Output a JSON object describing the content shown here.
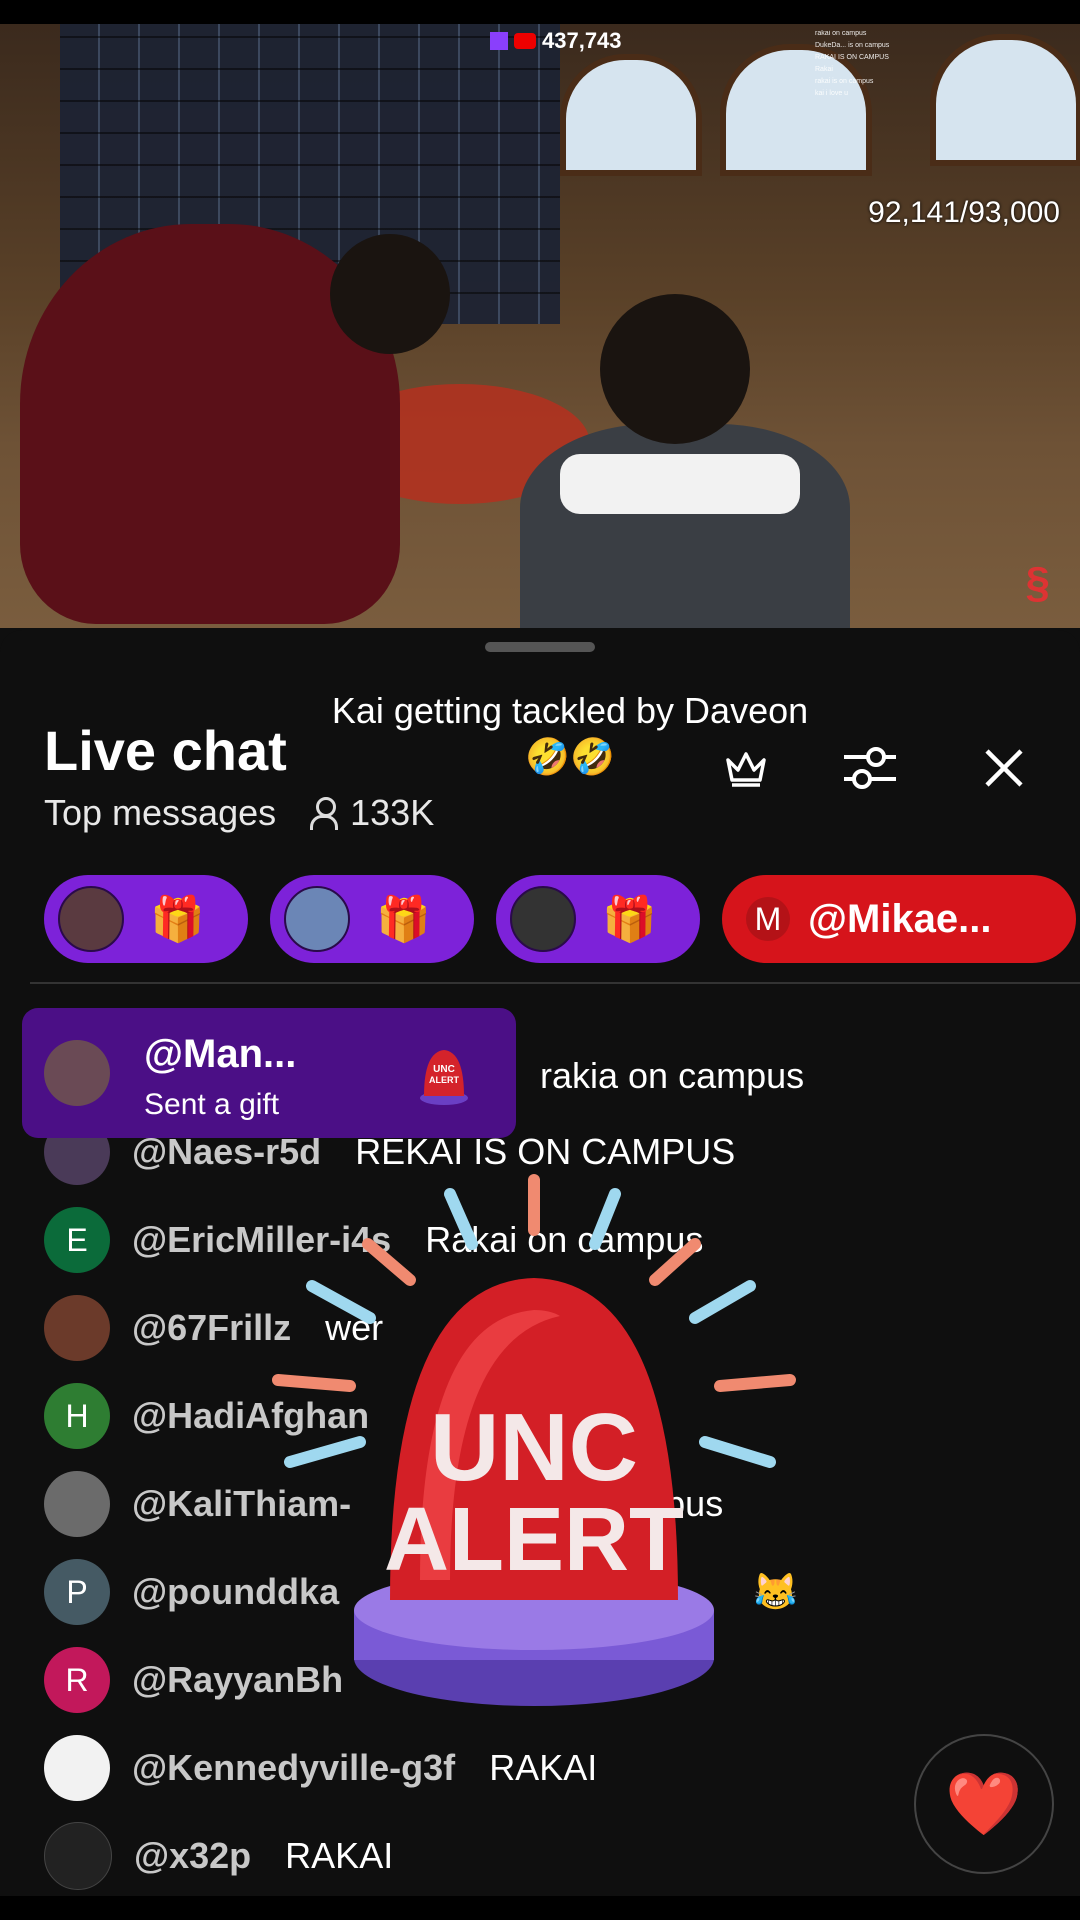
{
  "video": {
    "viewer_count": "437,743",
    "sub_counter": "92,141/93,000",
    "overlay_chat": [
      "rakai on campus",
      "DukeDa... is on campus",
      "RAKAI IS ON CAMPUS",
      "Rakai",
      "rakai is on campus",
      "kai i love u"
    ]
  },
  "chat": {
    "title": "Live chat",
    "mode": "Top messages",
    "viewers": "133K",
    "caption": "Kai getting tackled by Daveon🤣🤣",
    "icons": {
      "crown": "crown-icon",
      "filter": "sliders-icon",
      "close": "close-icon"
    }
  },
  "gifts": [
    {
      "icon": "gift-icon"
    },
    {
      "icon": "gift-icon"
    },
    {
      "icon": "gift-icon"
    }
  ],
  "mention": {
    "initial": "M",
    "handle": "@Mikae..."
  },
  "toast": {
    "name": "@Man...",
    "action": "Sent a gift",
    "badge": "UNC ALERT"
  },
  "messages": [
    {
      "initial": "",
      "user": "",
      "text": "rakia on campus",
      "avatar_color": "#3b2a3b"
    },
    {
      "initial": "",
      "user": "@Naes-r5d",
      "text": "REKAI IS ON CAMPUS",
      "avatar_color": "#4a3a58"
    },
    {
      "initial": "E",
      "user": "@EricMiller-i4s",
      "text": "Rakai on campus",
      "avatar_color": "#0b6b3a"
    },
    {
      "initial": "",
      "user": "@67Frillz",
      "text": "wer",
      "avatar_color": "#6b3a2a"
    },
    {
      "initial": "H",
      "user": "@HadiAfghan",
      "text": "o",
      "avatar_color": "#2e7d32"
    },
    {
      "initial": "",
      "user": "@KaliThiam-",
      "text": "ampus",
      "avatar_color": "#6b6b6b"
    },
    {
      "initial": "P",
      "user": "@pounddka",
      "text": "😹",
      "avatar_color": "#455a64"
    },
    {
      "initial": "R",
      "user": "@RayyanBh",
      "text": "",
      "avatar_color": "#c2185b"
    },
    {
      "initial": "",
      "user": "@Kennedyville-g3f",
      "text": "RAKAI",
      "avatar_color": "#f2f2f2"
    },
    {
      "initial": "",
      "user": "@x32p",
      "text": "RAKAI",
      "avatar_color": "#222"
    }
  ],
  "sticker": {
    "line1": "UNC",
    "line2": "ALERT"
  },
  "reaction": {
    "icon": "heart-icon",
    "glyph": "❤️"
  }
}
